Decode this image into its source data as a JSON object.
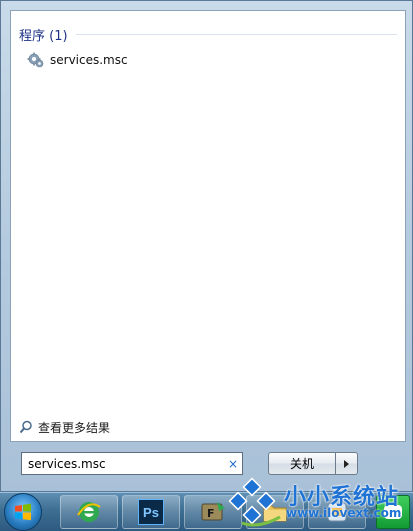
{
  "results": {
    "group_title": "程序 (1)",
    "items": [
      {
        "label": "services.msc",
        "icon": "gear-services-icon"
      }
    ]
  },
  "see_more": {
    "label": "查看更多结果",
    "icon": "search-icon"
  },
  "search": {
    "value": "services.msc",
    "clear_icon": "close-icon",
    "clear_glyph": "×"
  },
  "shutdown": {
    "label": "关机",
    "arrow_icon": "chevron-right-icon"
  },
  "taskbar": {
    "apps": [
      {
        "name": "windows-start-orb-icon"
      },
      {
        "name": "ie-browser-icon"
      },
      {
        "name": "photoshop-icon",
        "text": "Ps"
      },
      {
        "name": "app-icon"
      },
      {
        "name": "folder-icon"
      },
      {
        "name": "app-icon-2"
      }
    ]
  },
  "watermark": {
    "title": "小小系统站",
    "url": "www.ilovext.com"
  },
  "colors": {
    "accent": "#1e3287",
    "watermark": "#1f73d4"
  }
}
